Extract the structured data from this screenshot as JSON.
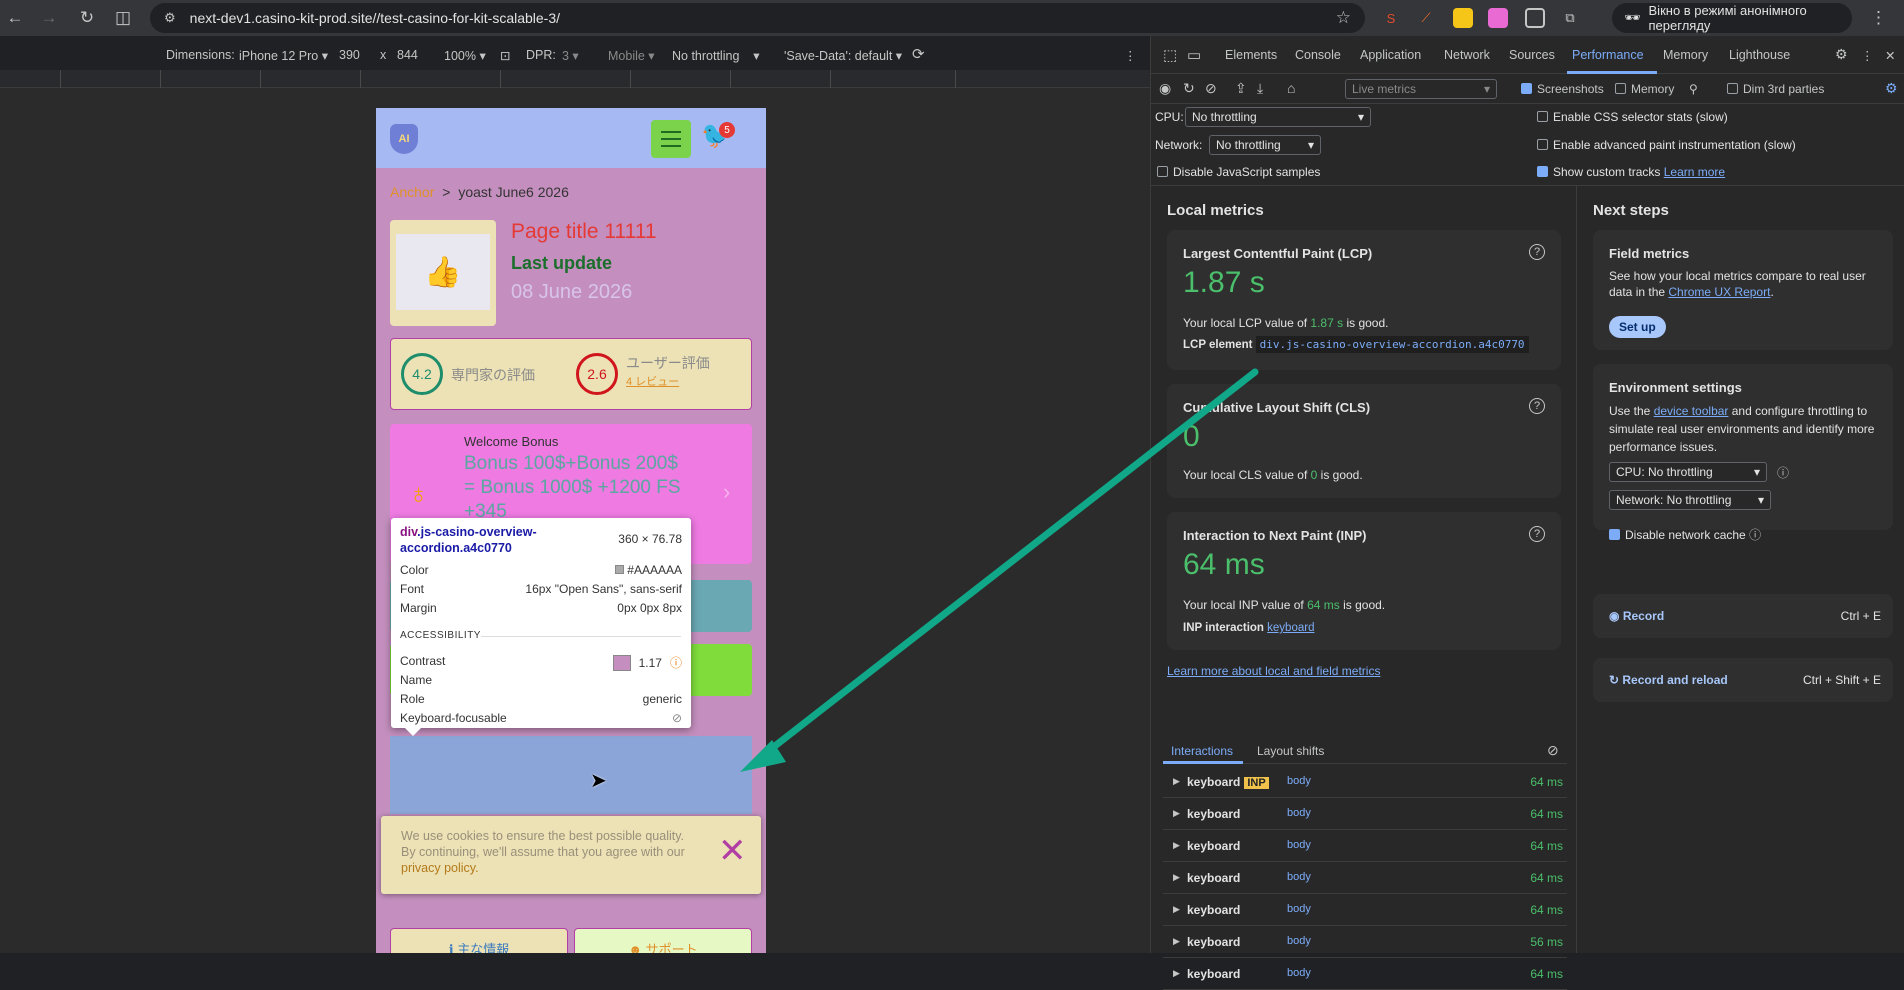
{
  "browser": {
    "url": "next-dev1.casino-kit-prod.site//test-casino-for-kit-scalable-3/",
    "incognito": "Вікно в режимі анонімного перегляду"
  },
  "device_toolbar": {
    "dimensions_label": "Dimensions:",
    "device": "iPhone 12 Pro",
    "width": "390",
    "x": "x",
    "height": "844",
    "zoom": "100%",
    "dpr_label": "DPR:",
    "dpr": "3",
    "mode": "Mobile",
    "throttle": "No throttling",
    "save_data": "'Save-Data': default"
  },
  "page": {
    "crumb_anchor": "Anchor",
    "crumb_sep": ">",
    "crumb_current": "yoast June6 2026",
    "title": "Page title 11111",
    "last_update": "Last update",
    "update_date": "08 June 2026",
    "expert_score": "4.2",
    "expert_label": "専門家の評価",
    "user_score": "2.6",
    "user_label": "ユーザー評価",
    "user_reviews": "4 レビュー",
    "bonus_label": "Welcome Bonus",
    "bonus_text": "Bonus 100$+Bonus 200$ = Bonus 1000$ +1200 FS +345",
    "cookie_text": "We use cookies to ensure the best possible quality. By continuing, we'll assume that you agree with our",
    "cookie_link": "privacy policy.",
    "bottom_btn1": "主な情報",
    "bottom_btn2": "サポート",
    "bird_badge": "5",
    "logo_text": "AI"
  },
  "tooltip": {
    "selector_tag": "div",
    "selector_rest": ".js-casino-overview-accordion.a4c0770",
    "size": "360 × 76.78",
    "color_label": "Color",
    "color_value": "#AAAAAA",
    "font_label": "Font",
    "font_value": "16px \"Open Sans\", sans-serif",
    "margin_label": "Margin",
    "margin_value": "0px 0px 8px",
    "accessibility": "ACCESSIBILITY",
    "contrast_label": "Contrast",
    "contrast_value": "1.17",
    "name_label": "Name",
    "role_label": "Role",
    "role_value": "generic",
    "kbd_label": "Keyboard-focusable"
  },
  "devtools": {
    "tabs": [
      "Elements",
      "Console",
      "Application",
      "Network",
      "Sources",
      "Performance",
      "Memory",
      "Lighthouse"
    ],
    "active_tab": "Performance",
    "live_metrics": "Live metrics",
    "screenshots": "Screenshots",
    "memory": "Memory",
    "dim3rd": "Dim 3rd parties",
    "cpu_label": "CPU:",
    "cpu_value": "No throttling",
    "net_label": "Network:",
    "net_value": "No throttling",
    "disable_js": "Disable JavaScript samples",
    "css_stats": "Enable CSS selector stats (slow)",
    "adv_paint": "Enable advanced paint instrumentation (slow)",
    "custom_tracks": "Show custom tracks",
    "learn_more": "Learn more",
    "local_metrics": "Local metrics",
    "lcp_title": "Largest Contentful Paint (LCP)",
    "lcp_value": "1.87 s",
    "lcp_desc_pre": "Your local LCP value of ",
    "lcp_desc_val": "1.87 s",
    "lcp_desc_post": " is good.",
    "lcp_el_label": "LCP element",
    "lcp_el": "div.js-casino-overview-accordion.a4c0770",
    "cls_title": "Cumulative Layout Shift (CLS)",
    "cls_value": "0",
    "cls_desc_pre": "Your local CLS value of ",
    "cls_desc_val": "0",
    "cls_desc_post": " is good.",
    "inp_title": "Interaction to Next Paint (INP)",
    "inp_value": "64 ms",
    "inp_desc_pre": "Your local INP value of ",
    "inp_desc_val": "64 ms",
    "inp_desc_post": " is good.",
    "inp_int_label": "INP interaction",
    "inp_int": "keyboard",
    "learn_local": "Learn more about local and field metrics",
    "tab_interactions": "Interactions",
    "tab_layout": "Layout shifts",
    "interactions": [
      {
        "type": "keyboard",
        "inp": "INP",
        "target": "body",
        "ms": "64 ms"
      },
      {
        "type": "keyboard",
        "inp": "",
        "target": "body",
        "ms": "64 ms"
      },
      {
        "type": "keyboard",
        "inp": "",
        "target": "body",
        "ms": "64 ms"
      },
      {
        "type": "keyboard",
        "inp": "",
        "target": "body",
        "ms": "64 ms"
      },
      {
        "type": "keyboard",
        "inp": "",
        "target": "body",
        "ms": "64 ms"
      },
      {
        "type": "keyboard",
        "inp": "",
        "target": "body",
        "ms": "56 ms"
      },
      {
        "type": "keyboard",
        "inp": "",
        "target": "body",
        "ms": "64 ms"
      }
    ],
    "next_steps": "Next steps",
    "field_title": "Field metrics",
    "field_desc_pre": "See how your local metrics compare to real user data in the ",
    "field_link": "Chrome UX Report",
    "field_desc_post": ".",
    "setup": "Set up",
    "env_title": "Environment settings",
    "env_desc_pre": "Use the ",
    "env_link": "device toolbar",
    "env_desc_post": " and configure throttling to simulate real user environments and identify more performance issues.",
    "env_cpu": "CPU: No throttling",
    "env_net": "Network: No throttling",
    "disable_cache": "Disable network cache",
    "record": "Record",
    "record_key": "Ctrl + E",
    "record_reload": "Record and reload",
    "record_reload_key": "Ctrl + Shift + E"
  },
  "colors": {
    "good": "#4bbf6b",
    "accent": "#7cacf8",
    "arrow": "#11a889"
  }
}
